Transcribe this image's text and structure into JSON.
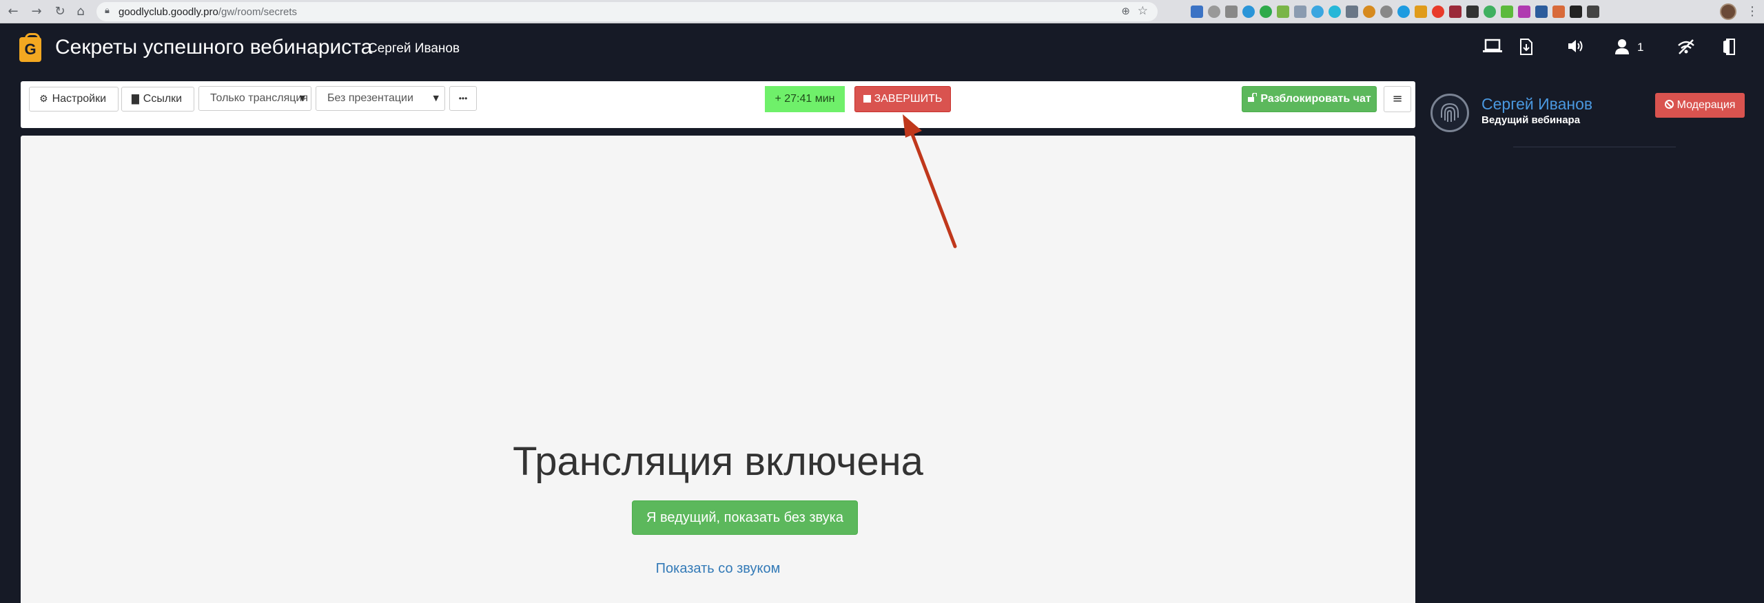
{
  "browser": {
    "url_host": "goodlyclub.goodly.pro",
    "url_path": "/gw/room/secrets"
  },
  "header": {
    "logo": "G",
    "title": "Секреты успешного вебинариста",
    "host_name": "Сергей Иванов",
    "participants_count": "1"
  },
  "toolbar": {
    "settings_label": "Настройки",
    "links_label": "Ссылки",
    "mode_select_value": "Только трансляция",
    "presentation_select_value": "Без презентации",
    "more_label": "•••",
    "timer_label": "+ 27:41 мин",
    "finish_label": "ЗАВЕРШИТЬ",
    "unlock_chat_label": "Разблокировать чат"
  },
  "stage": {
    "heading": "Трансляция включена",
    "host_silent_button": "Я ведущий, показать без звука",
    "show_with_sound_link": "Показать со звуком"
  },
  "right_panel": {
    "user_name": "Сергей Иванов",
    "user_role": "Ведущий вебинара",
    "moderation_label": "Модерация"
  },
  "colors": {
    "background": "#161a26",
    "finish": "#d9534f",
    "success": "#5cb85c",
    "timer": "#6ff06a",
    "link": "#337ab7",
    "name_accent": "#4a98e0",
    "annotation_arrow": "#c0381c"
  },
  "icons": {
    "settings": "gear-icon",
    "links": "file-icon",
    "finish": "stop-icon",
    "unlock": "unlock-icon",
    "menu": "hamburger-icon",
    "moderation": "ban-icon",
    "header": [
      "laptop-icon",
      "download-file-icon",
      "volume-icon",
      "user-icon",
      "no-signal-icon",
      "exit-door-icon"
    ]
  }
}
